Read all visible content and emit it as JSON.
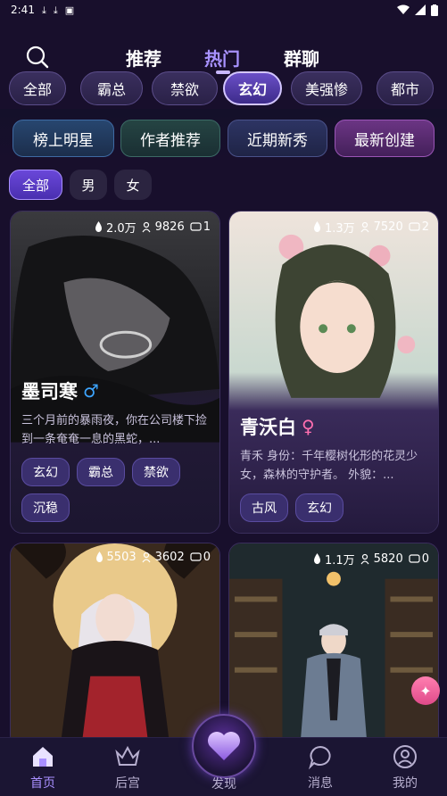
{
  "status_bar": {
    "time": "2:41"
  },
  "top_tabs": [
    {
      "label": "推荐"
    },
    {
      "label": "热门"
    },
    {
      "label": "群聊"
    }
  ],
  "categories": [
    "全部",
    "霸总",
    "禁欲",
    "玄幻",
    "美强惨",
    "都市"
  ],
  "active_category": "玄幻",
  "ranking": [
    "榜上明星",
    "作者推荐",
    "近期新秀",
    "最新创建"
  ],
  "gender_filter": [
    "全部",
    "男",
    "女"
  ],
  "cards": [
    {
      "name": "墨司寒",
      "gender": "♂",
      "likes": "2.0万",
      "users": "9826",
      "comments": "1",
      "description": "三个月前的暴雨夜，你在公司楼下捡到一条奄奄一息的黑蛇，...",
      "tags": [
        "玄幻",
        "霸总",
        "禁欲",
        "沉稳"
      ]
    },
    {
      "name": "青沃白",
      "gender": "♀",
      "likes": "1.3万",
      "users": "7520",
      "comments": "2",
      "description": "青禾 身份：千年樱树化形的花灵少女，森林的守护者。 外貌：...",
      "tags": [
        "古风",
        "玄幻"
      ]
    },
    {
      "likes": "5503",
      "users": "3602",
      "comments": "0"
    },
    {
      "likes": "1.1万",
      "users": "5820",
      "comments": "0"
    }
  ],
  "bottom_nav": {
    "home": "首页",
    "harem": "后宫",
    "discover": "发现",
    "messages": "消息",
    "mine": "我的"
  },
  "colors": {
    "background": "#180f2c",
    "accent": "#a892ff",
    "active_chip": "#6a4fc7"
  }
}
